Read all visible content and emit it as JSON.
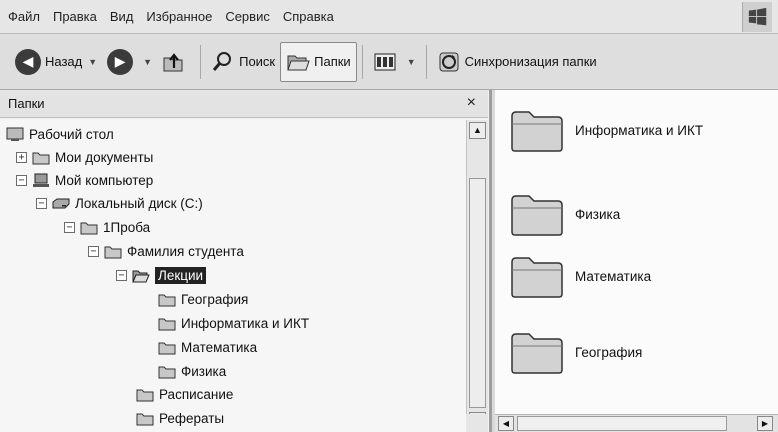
{
  "menu": {
    "file": "Файл",
    "edit": "Правка",
    "view": "Вид",
    "favorites": "Избранное",
    "service": "Сервис",
    "help": "Справка"
  },
  "toolbar": {
    "back": "Назад",
    "search": "Поиск",
    "folders": "Папки",
    "sync": "Синхронизация папки"
  },
  "folders_pane": {
    "title": "Папки",
    "close": "×",
    "tree": [
      {
        "label": "Рабочий стол",
        "icon": "desktop-icon",
        "expander": ""
      },
      {
        "label": "Мои документы",
        "icon": "folder-icon",
        "expander": "+"
      },
      {
        "label": "Мой компьютер",
        "icon": "computer-icon",
        "expander": "−"
      },
      {
        "label": "Локальный диск (C:)",
        "icon": "drive-icon",
        "expander": "−"
      },
      {
        "label": "1Проба",
        "icon": "folder-icon",
        "expander": "−"
      },
      {
        "label": "Фамилия студента",
        "icon": "folder-icon",
        "expander": "−"
      },
      {
        "label": "Лекции",
        "icon": "folder-open-icon",
        "expander": "−",
        "selected": true
      },
      {
        "label": "География",
        "icon": "folder-icon",
        "expander": ""
      },
      {
        "label": "Информатика и ИКТ",
        "icon": "folder-icon",
        "expander": ""
      },
      {
        "label": "Математика",
        "icon": "folder-icon",
        "expander": ""
      },
      {
        "label": "Физика",
        "icon": "folder-icon",
        "expander": ""
      },
      {
        "label": "Расписание",
        "icon": "folder-icon",
        "expander": ""
      },
      {
        "label": "Рефераты",
        "icon": "folder-icon",
        "expander": ""
      }
    ]
  },
  "contents": [
    {
      "label": "Информатика и ИКТ",
      "icon": "folder-icon"
    },
    {
      "label": "Физика",
      "icon": "folder-icon"
    },
    {
      "label": "Математика",
      "icon": "folder-icon"
    },
    {
      "label": "География",
      "icon": "folder-icon"
    }
  ]
}
